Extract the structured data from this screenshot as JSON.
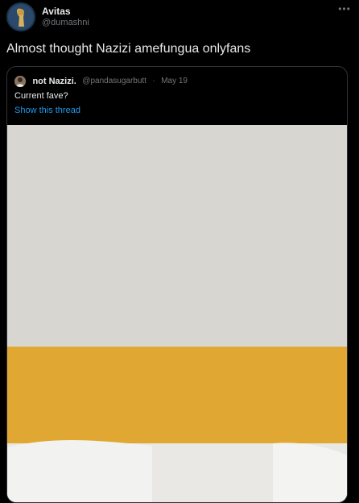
{
  "tweet": {
    "author": {
      "display_name": "Avitas",
      "handle": "@dumashni",
      "avatar_icon": "user-avatar-icon"
    },
    "more_icon": "more-horizontal-icon",
    "more_glyph": "•••",
    "text": "Almost thought Nazizi amefungua onlyfans"
  },
  "quoted_tweet": {
    "author": {
      "display_name": "not Nazizi.",
      "handle": "@pandasugarbutt",
      "separator": "·",
      "date": "May 19",
      "avatar_icon": "user-avatar-icon"
    },
    "text": "Current fave?",
    "show_thread_label": "Show this thread",
    "media": {
      "kind": "photo",
      "description_icon": "photo-icon"
    }
  },
  "colors": {
    "background": "#000000",
    "text_primary": "#e7e9ea",
    "text_secondary": "#71767b",
    "link": "#1d9bf0",
    "border": "#2f3336"
  }
}
